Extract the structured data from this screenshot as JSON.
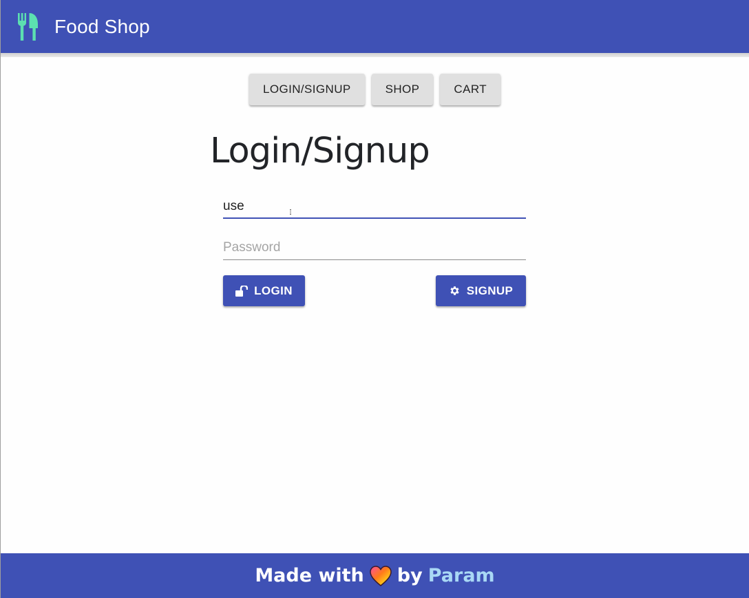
{
  "app_bar": {
    "title": "Food Shop",
    "logo_icon": "utensils-icon",
    "background": "#3f51b5",
    "logo_color": "#5ce0b0"
  },
  "nav": {
    "items": [
      {
        "label": "LOGIN/SIGNUP"
      },
      {
        "label": "SHOP"
      },
      {
        "label": "CART"
      }
    ]
  },
  "main": {
    "heading": "Login/Signup",
    "username": {
      "value": "use",
      "placeholder": ""
    },
    "password": {
      "value": "",
      "placeholder": "Password"
    },
    "login_button": {
      "label": "LOGIN",
      "icon": "unlock-icon"
    },
    "signup_button": {
      "label": "SIGNUP",
      "icon": "gear-icon"
    }
  },
  "footer": {
    "prefix": "Made with",
    "heart_icon": "heart-icon",
    "middle": "by",
    "author": "Param"
  },
  "colors": {
    "primary": "#3f51b5",
    "accent_link": "#a9d8f5",
    "nav_button_bg": "#e0e0e0"
  }
}
